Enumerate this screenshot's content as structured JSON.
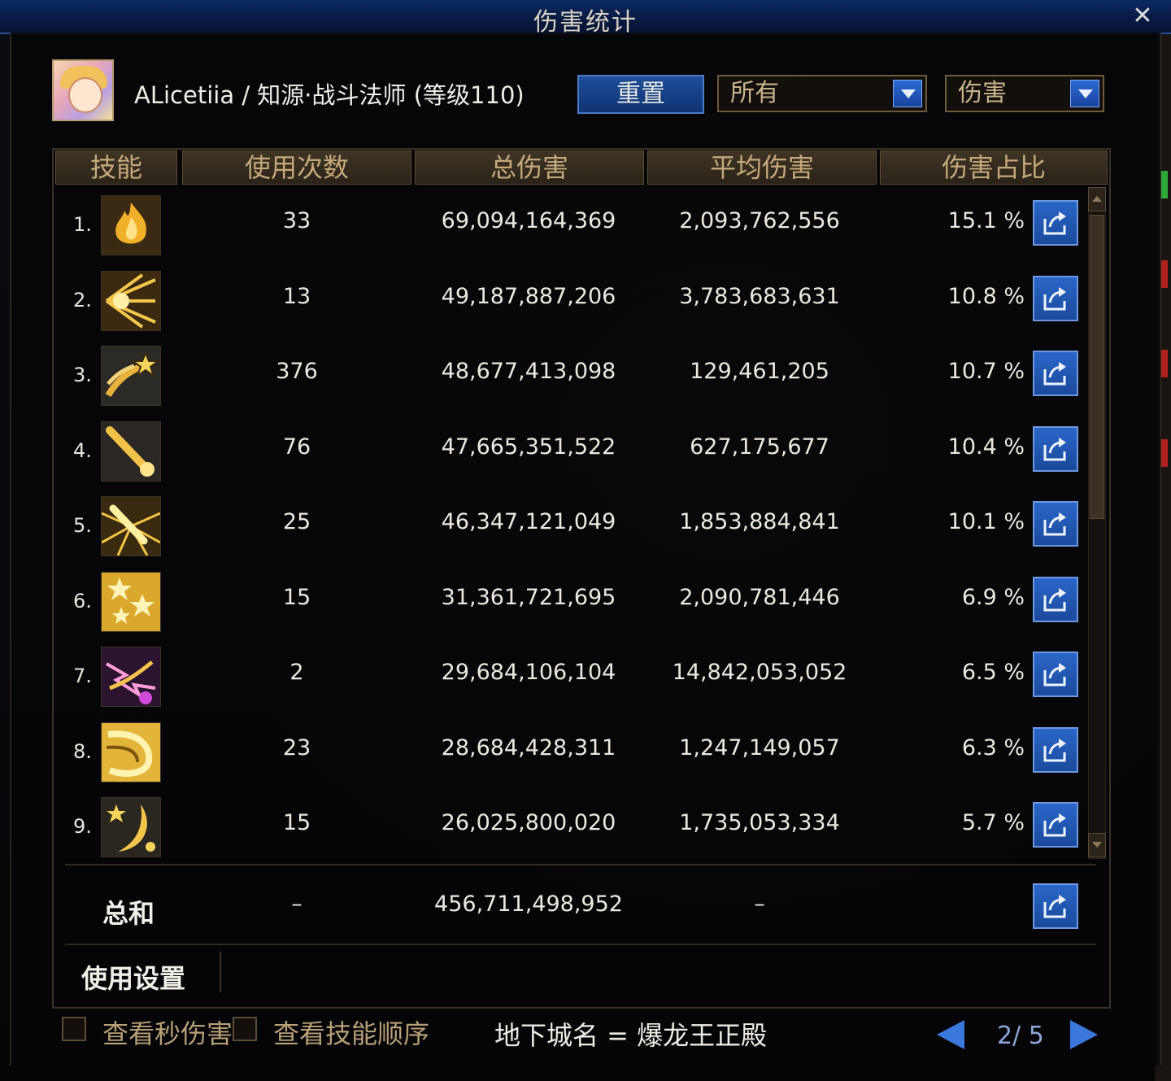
{
  "window": {
    "title": "伤害统计"
  },
  "header": {
    "character": "ALicetiia / 知源·战斗法师 (等级110)",
    "reset_label": "重置",
    "filter_target": "所有",
    "filter_stat": "伤害"
  },
  "table": {
    "columns": [
      "技能",
      "使用次数",
      "总伤害",
      "平均伤害",
      "伤害占比"
    ],
    "rows": [
      {
        "rank": "1.",
        "uses": "33",
        "total": "69,094,164,369",
        "avg": "2,093,762,556",
        "pct": "15.1 %",
        "icon": "flame-burst-icon"
      },
      {
        "rank": "2.",
        "uses": "13",
        "total": "49,187,887,206",
        "avg": "3,783,683,631",
        "pct": "10.8 %",
        "icon": "star-rays-icon"
      },
      {
        "rank": "3.",
        "uses": "376",
        "total": "48,677,413,098",
        "avg": "129,461,205",
        "pct": "10.7 %",
        "icon": "comet-star-icon"
      },
      {
        "rank": "4.",
        "uses": "76",
        "total": "47,665,351,522",
        "avg": "627,175,677",
        "pct": "10.4 %",
        "icon": "staff-swing-icon"
      },
      {
        "rank": "5.",
        "uses": "25",
        "total": "46,347,121,049",
        "avg": "1,853,884,841",
        "pct": "10.1 %",
        "icon": "staff-burst-icon"
      },
      {
        "rank": "6.",
        "uses": "15",
        "total": "31,361,721,695",
        "avg": "2,090,781,446",
        "pct": "6.9 %",
        "icon": "stars-cluster-icon"
      },
      {
        "rank": "7.",
        "uses": "2",
        "total": "29,684,106,104",
        "avg": "14,842,053,052",
        "pct": "6.5 %",
        "icon": "lightning-magic-icon"
      },
      {
        "rank": "8.",
        "uses": "23",
        "total": "28,684,428,311",
        "avg": "1,247,149,057",
        "pct": "6.3 %",
        "icon": "swirl-slash-icon"
      },
      {
        "rank": "9.",
        "uses": "15",
        "total": "26,025,800,020",
        "avg": "1,735,053,334",
        "pct": "5.7 %",
        "icon": "crescent-moon-icon"
      }
    ],
    "total": {
      "label": "总和",
      "uses": "–",
      "total": "456,711,498,952",
      "avg": "–"
    }
  },
  "settings": {
    "label": "使用设置"
  },
  "footer": {
    "opt_dps": "查看秒伤害",
    "opt_order": "查看技能顺序",
    "dungeon": "地下城名 = 爆龙王正殿",
    "page": "2/ 5"
  }
}
